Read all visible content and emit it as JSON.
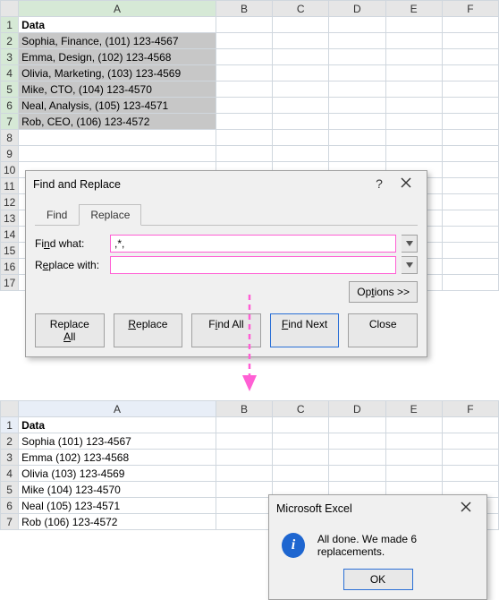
{
  "sheet1": {
    "columns": [
      "A",
      "B",
      "C",
      "D",
      "E",
      "F"
    ],
    "header_cell": "Data",
    "rows": [
      "Sophia, Finance, (101) 123-4567",
      "Emma, Design, (102) 123-4568",
      "Olivia, Marketing, (103) 123-4569",
      "Mike, CTO, (104) 123-4570",
      "Neal, Analysis, (105) 123-4571",
      "Rob, CEO, (106) 123-4572"
    ],
    "row_numbers": [
      "1",
      "2",
      "3",
      "4",
      "5",
      "6",
      "7",
      "8",
      "9",
      "10",
      "11",
      "12",
      "13",
      "14",
      "15",
      "16",
      "17"
    ]
  },
  "find_replace": {
    "title": "Find and Replace",
    "help": "?",
    "tabs": {
      "find": "Find",
      "replace": "Replace"
    },
    "find_label_pre": "Fi",
    "find_label_u": "n",
    "find_label_post": "d what:",
    "replace_label_pre": "R",
    "replace_label_u": "e",
    "replace_label_post": "place with:",
    "find_value": ",*,",
    "replace_value": "",
    "options_pre": "Op",
    "options_u": "t",
    "options_post": "ions >>",
    "buttons": {
      "replace_all_pre": "Replace ",
      "replace_all_u": "A",
      "replace_all_post": "ll",
      "replace_u": "R",
      "replace_post": "eplace",
      "find_all_pre": "F",
      "find_all_u": "i",
      "find_all_post": "nd All",
      "find_next_u": "F",
      "find_next_post": "ind Next",
      "close": "Close"
    }
  },
  "sheet2": {
    "columns": [
      "A",
      "B",
      "C",
      "D",
      "E",
      "F"
    ],
    "header_cell": "Data",
    "rows": [
      "Sophia (101) 123-4567",
      "Emma (102) 123-4568",
      "Olivia (103) 123-4569",
      "Mike (104) 123-4570",
      "Neal (105) 123-4571",
      "Rob (106) 123-4572"
    ],
    "row_numbers": [
      "1",
      "2",
      "3",
      "4",
      "5",
      "6",
      "7"
    ]
  },
  "msgbox": {
    "title": "Microsoft Excel",
    "message": "All done. We made 6 replacements.",
    "ok": "OK"
  }
}
